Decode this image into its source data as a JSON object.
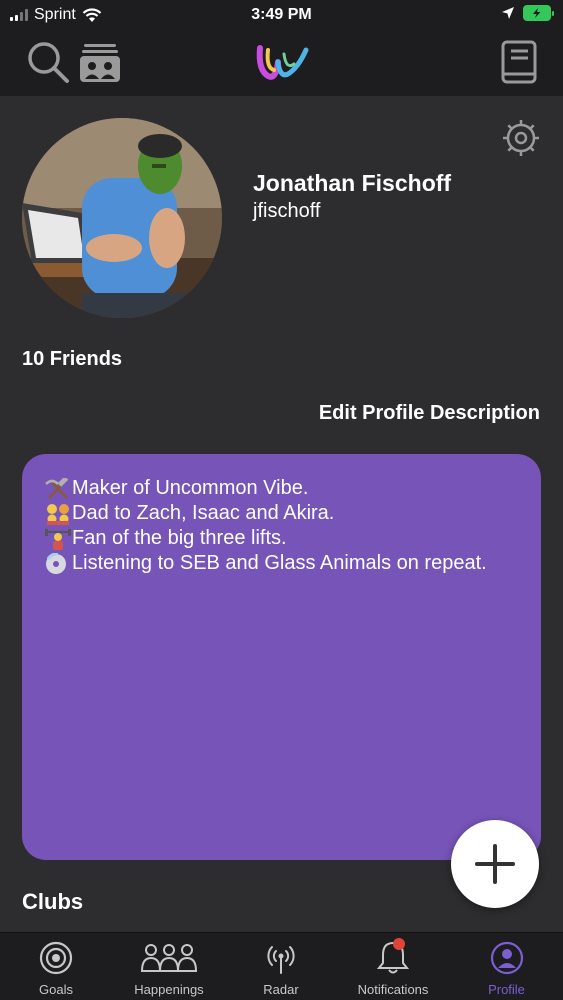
{
  "status_bar": {
    "carrier": "Sprint",
    "time": "3:49 PM"
  },
  "top_nav": {
    "icons": [
      "search-icon",
      "happenings-feed-icon",
      "app-logo",
      "book-icon"
    ]
  },
  "profile": {
    "name": "Jonathan Fischoff",
    "handle": "jfischoff",
    "friends": "10 Friends",
    "edit_description": "Edit Profile Description",
    "description_lines": [
      {
        "emoji": "hammer-pick",
        "text": "Maker of Uncommon Vibe."
      },
      {
        "emoji": "family",
        "text": "Dad to Zach, Isaac and Akira."
      },
      {
        "emoji": "weightlifter",
        "text": "Fan of the big three lifts."
      },
      {
        "emoji": "cd",
        "text": "Listening to SEB and Glass Animals on repeat."
      }
    ],
    "description_color": "#7654b8"
  },
  "sections": {
    "clubs": "Clubs"
  },
  "tab_bar": {
    "tabs": [
      {
        "label": "Goals",
        "icon": "target-icon"
      },
      {
        "label": "Happenings",
        "icon": "people-icon"
      },
      {
        "label": "Radar",
        "icon": "radar-icon"
      },
      {
        "label": "Notifications",
        "icon": "bell-icon"
      },
      {
        "label": "Profile",
        "icon": "profile-icon"
      }
    ],
    "active": "Profile",
    "active_color": "#7c5fd3"
  }
}
